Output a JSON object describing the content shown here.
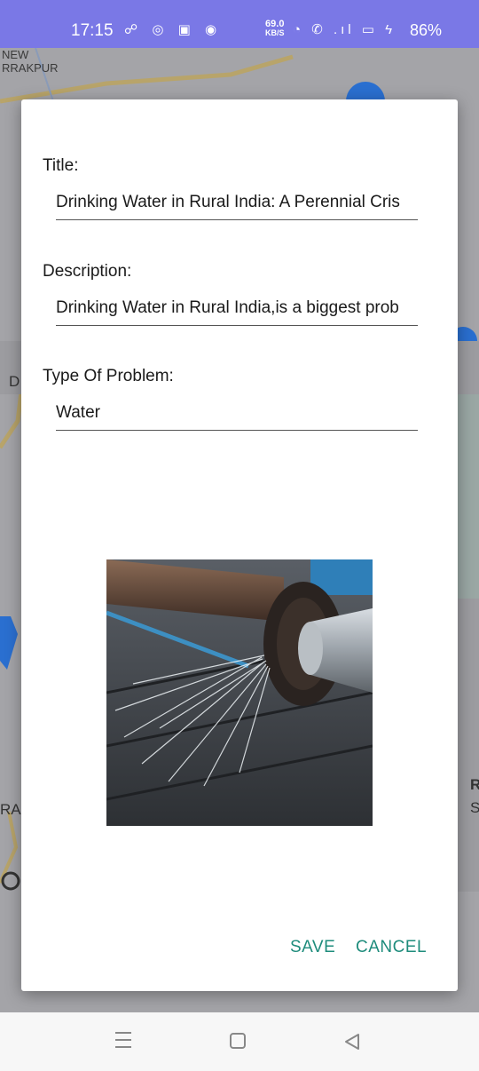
{
  "status_bar": {
    "time": "17:15",
    "left_icons": "☍ ◎ ▣ ◉",
    "speed_value": "69.0",
    "speed_unit": "KB/S",
    "right_icons": "◔ ✆ .ıl ▭ ϟ",
    "battery": "86%"
  },
  "map": {
    "label_area": "NEW\nRRAKPUR",
    "side_text_left_1": "D",
    "side_text_left_2": "RA",
    "side_text_right_1": "R",
    "side_text_right_2": "S"
  },
  "dialog": {
    "title_label": "Title:",
    "title_value": "Drinking Water in Rural India: A Perennial Cris",
    "description_label": "Description:",
    "description_value": "Drinking Water in Rural India,is a biggest prob",
    "type_label": "Type Of Problem:",
    "type_value": "Water",
    "save_label": "SAVE",
    "cancel_label": "CANCEL"
  },
  "colors": {
    "status_bar": "#7a78e6",
    "accent": "#1e8c7c"
  }
}
